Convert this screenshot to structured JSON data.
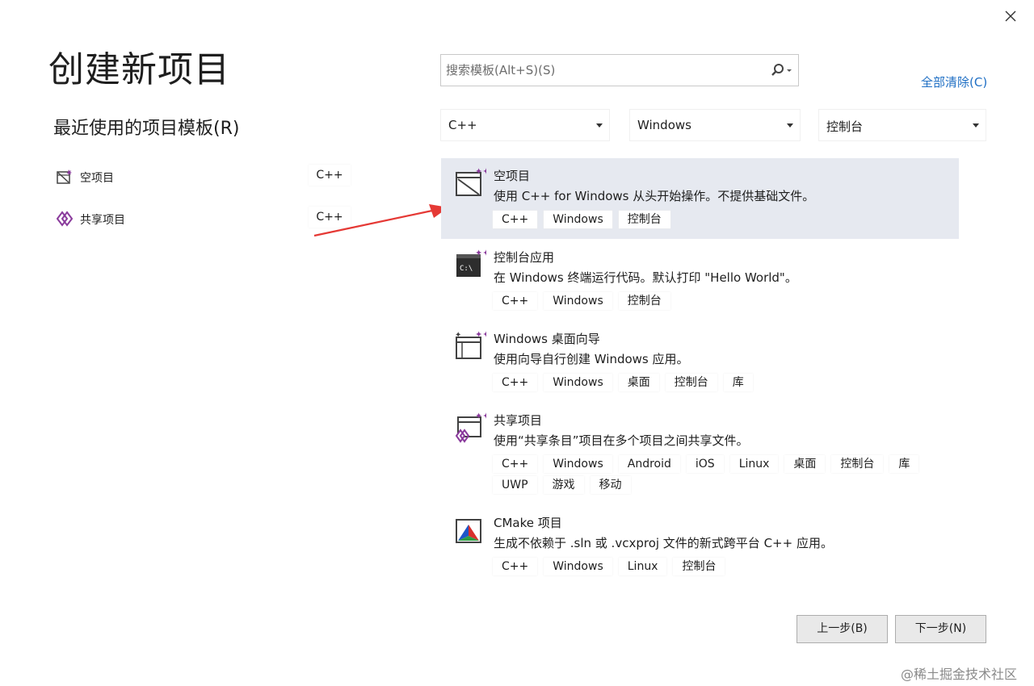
{
  "dialog": {
    "title": "创建新项目",
    "recent_header": "最近使用的项目模板(R)"
  },
  "search": {
    "placeholder": "搜索模板(Alt+S)(S)"
  },
  "clear_all": "全部清除(C)",
  "filters": {
    "language": "C++",
    "platform": "Windows",
    "project_type": "控制台"
  },
  "recent": [
    {
      "name": "空项目",
      "lang": "C++",
      "icon": "empty-project-icon"
    },
    {
      "name": "共享项目",
      "lang": "C++",
      "icon": "shared-project-icon"
    }
  ],
  "templates": [
    {
      "name": "空项目",
      "desc": "使用 C++ for Windows 从头开始操作。不提供基础文件。",
      "tags": [
        "C++",
        "Windows",
        "控制台"
      ],
      "selected": true,
      "icon": "empty-project-icon"
    },
    {
      "name": "控制台应用",
      "desc": "在 Windows 终端运行代码。默认打印 \"Hello World\"。",
      "tags": [
        "C++",
        "Windows",
        "控制台"
      ],
      "icon": "console-app-icon"
    },
    {
      "name": "Windows 桌面向导",
      "desc": "使用向导自行创建 Windows 应用。",
      "tags": [
        "C++",
        "Windows",
        "桌面",
        "控制台",
        "库"
      ],
      "icon": "desktop-wizard-icon"
    },
    {
      "name": "共享项目",
      "desc": "使用“共享条目”项目在多个项目之间共享文件。",
      "tags": [
        "C++",
        "Windows",
        "Android",
        "iOS",
        "Linux",
        "桌面",
        "控制台",
        "库",
        "UWP",
        "游戏",
        "移动"
      ],
      "icon": "shared-project-icon"
    },
    {
      "name": "CMake 项目",
      "desc": "生成不依赖于 .sln 或 .vcxproj 文件的新式跨平台 C++ 应用。",
      "tags": [
        "C++",
        "Windows",
        "Linux",
        "控制台"
      ],
      "icon": "cmake-icon"
    }
  ],
  "buttons": {
    "back": "上一步(B)",
    "next": "下一步(N)"
  },
  "watermark": "@稀土掘金技术社区",
  "colors": {
    "accent_link": "#1f6fc4",
    "selected_row": "#e6e9f0",
    "arrow": "#e53935"
  }
}
